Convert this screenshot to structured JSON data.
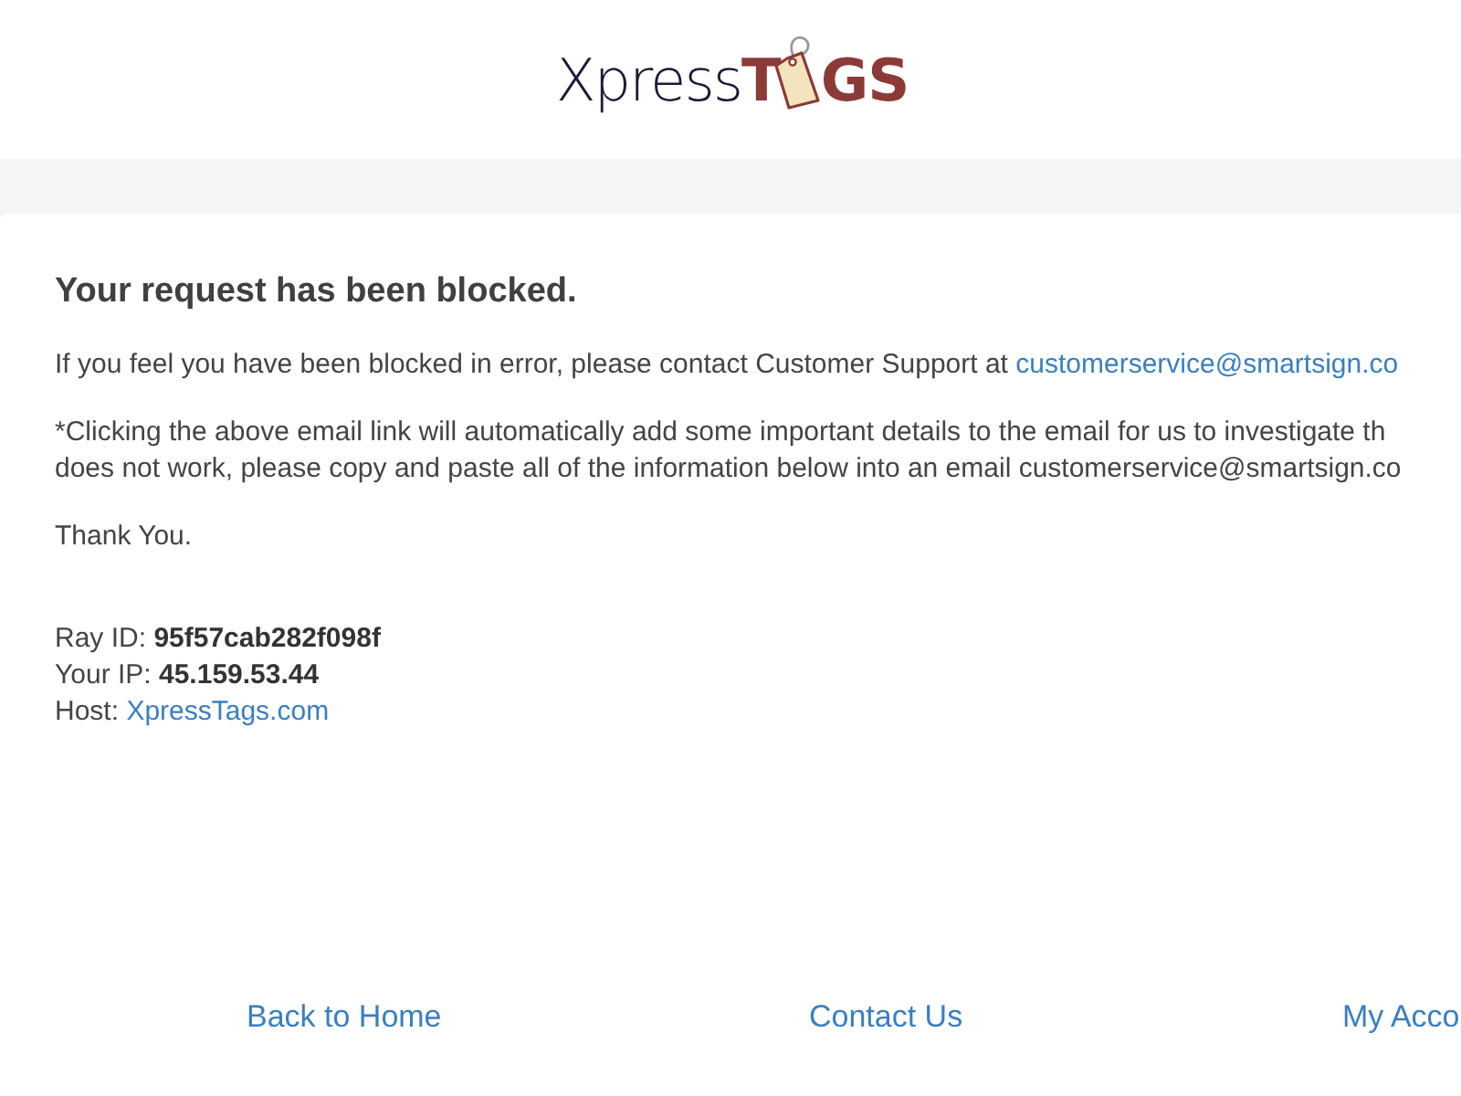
{
  "logo": {
    "light": "Xpress",
    "bold_before_tag": "T",
    "bold_after_tag": "GS"
  },
  "message": {
    "title": "Your request has been blocked.",
    "contact_text": "If you feel you have been blocked in error, please contact Customer Support at",
    "contact_email": "customerservice@smartsign.co",
    "note_lines": [
      "*Clicking the above email link will automatically add some important details to the email for us to investigate th",
      "does not work, please copy and paste all of the information below into an email customerservice@smartsign.co"
    ],
    "thanks": "Thank You."
  },
  "details": [
    {
      "kind": "bold",
      "label": "Ray ID:",
      "value": "95f57cab282f098f"
    },
    {
      "kind": "bold",
      "label": "Your IP:",
      "value": "45.159.53.44"
    },
    {
      "kind": "link",
      "label": "Host:",
      "value": "XpressTags.com"
    }
  ],
  "footer_links": [
    "Back to Home",
    "Contact Us",
    "My Acco"
  ]
}
